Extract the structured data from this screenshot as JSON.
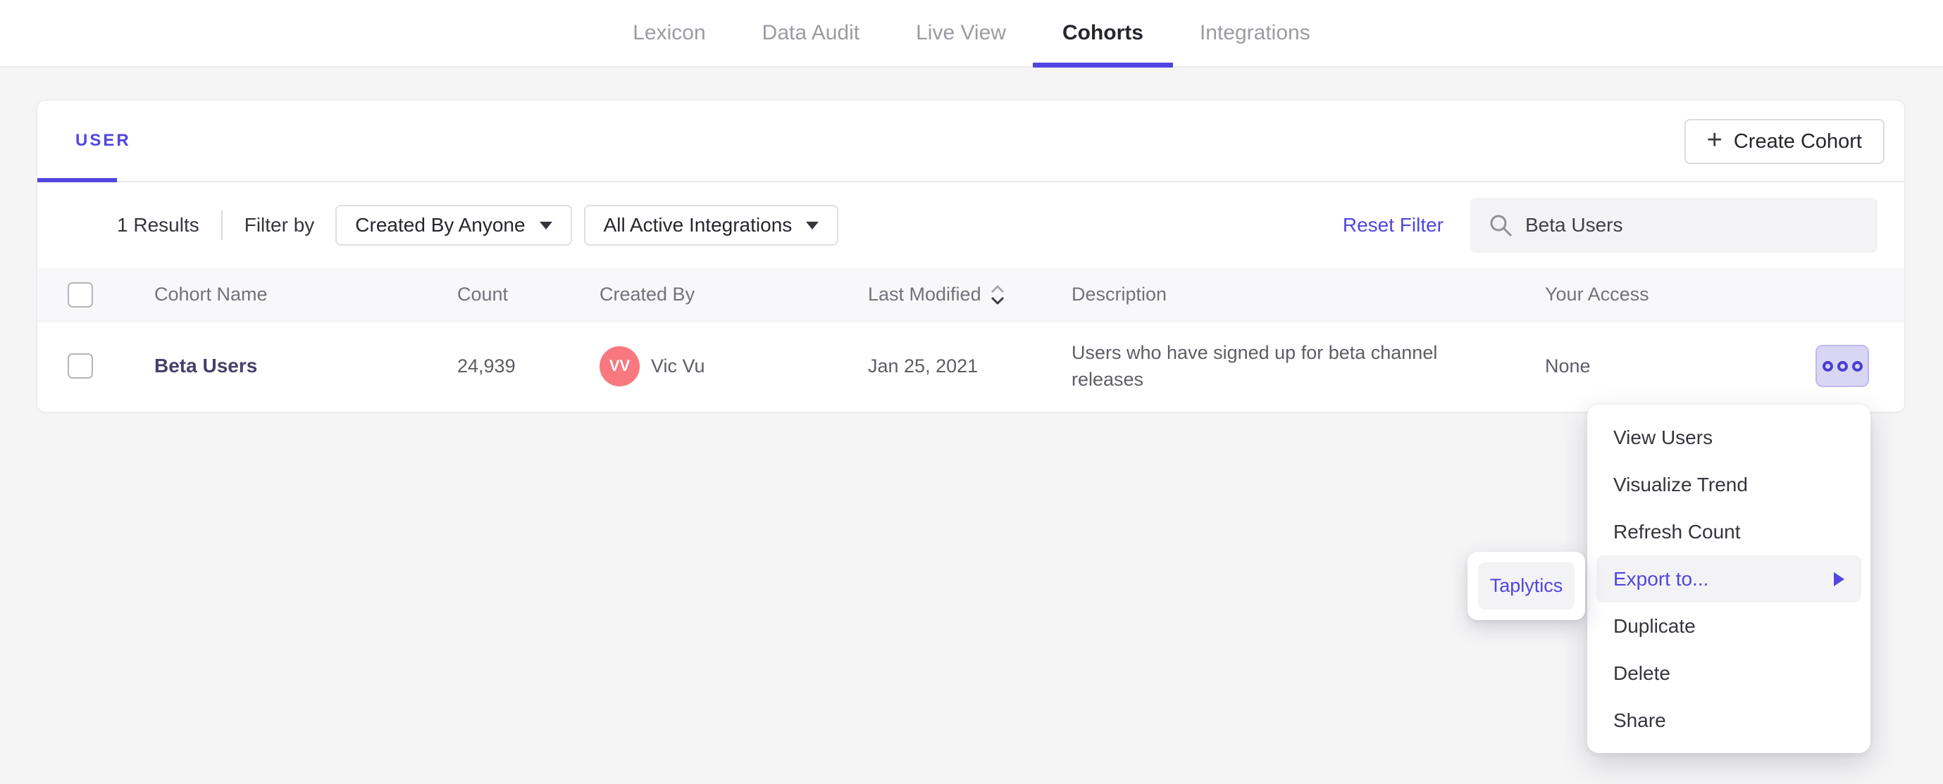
{
  "nav": {
    "tabs": [
      {
        "label": "Lexicon"
      },
      {
        "label": "Data Audit"
      },
      {
        "label": "Live View"
      },
      {
        "label": "Cohorts",
        "active": true
      },
      {
        "label": "Integrations"
      }
    ]
  },
  "cohorts_card": {
    "tab_label": "USER",
    "plus_icon": "+",
    "create_cohort_button": "Create Cohort",
    "filter_bar": {
      "results_count": "1 Results",
      "filter_by_label": "Filter by",
      "created_by_dropdown": "Created By Anyone",
      "integrations_dropdown": "All Active Integrations",
      "reset_filter_link": "Reset Filter",
      "search": {
        "value": "Beta Users"
      }
    },
    "table": {
      "headers": {
        "cohort_name": "Cohort Name",
        "count": "Count",
        "created_by": "Created By",
        "last_modified": "Last Modified",
        "description": "Description",
        "your_access": "Your Access"
      },
      "rows": [
        {
          "name": "Beta Users",
          "count": "24,939",
          "avatar_initials": "VV",
          "created_by": "Vic Vu",
          "last_modified": "Jan 25, 2021",
          "description": "Users who have signed up for beta channel releases",
          "your_access": "None"
        }
      ]
    }
  },
  "context_menu": {
    "items": [
      {
        "label": "View Users"
      },
      {
        "label": "Visualize Trend"
      },
      {
        "label": "Refresh Count"
      },
      {
        "label": "Export to...",
        "highlighted": true
      },
      {
        "label": "Duplicate"
      },
      {
        "label": "Delete"
      },
      {
        "label": "Share"
      }
    ]
  },
  "export_submenu": {
    "items": [
      {
        "label": "Taplytics"
      }
    ]
  },
  "colors": {
    "accent": "#5146df",
    "avatar": "#f7787e",
    "cohort_link": "#454169",
    "actions_button_bg": "#d9d6f4",
    "page_background": "#f5f5f6",
    "table_header_bg": "#f8f8fa"
  }
}
